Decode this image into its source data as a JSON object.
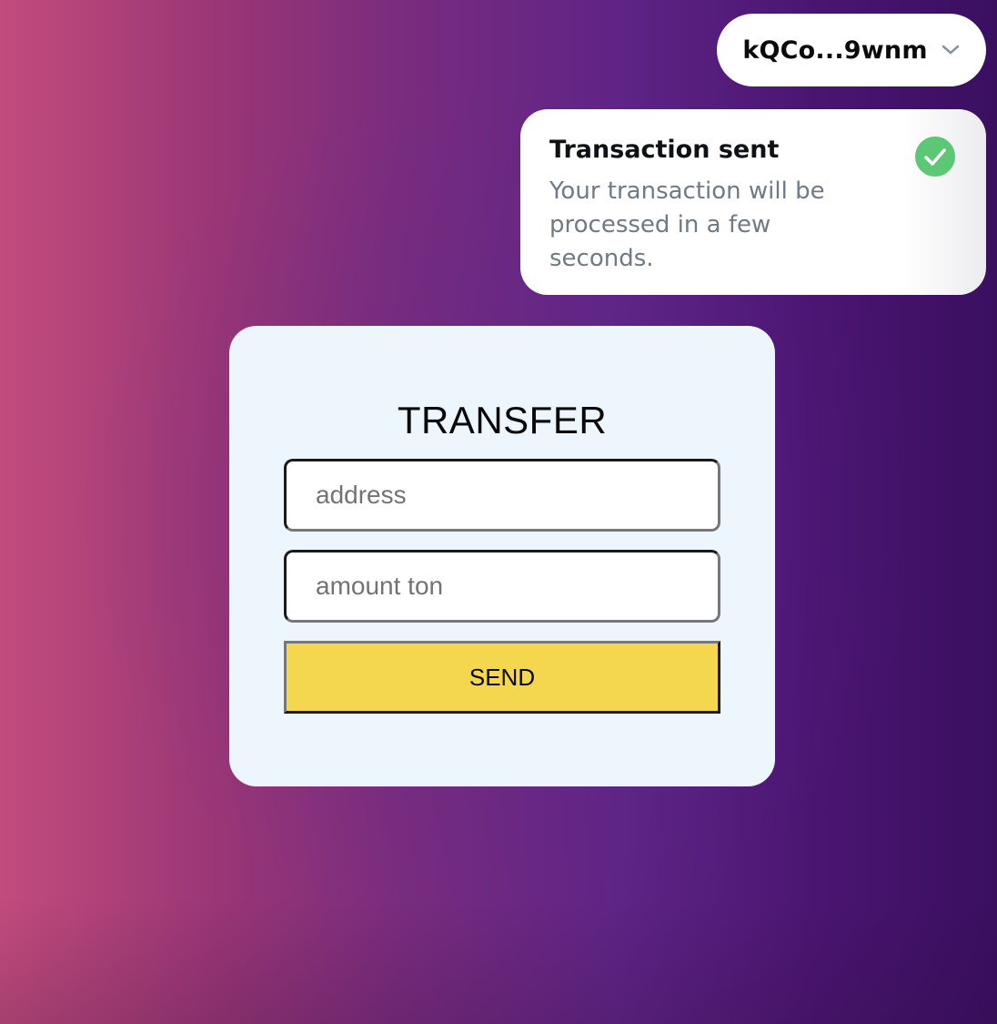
{
  "wallet": {
    "address": "kQCo...9wnm",
    "dropdown_icon": "chevron-down-icon"
  },
  "toast": {
    "title": "Transaction sent",
    "message": "Your transaction will be processed in a few seconds.",
    "status_icon": "check-circle-icon",
    "status_color": "#5cc775"
  },
  "transfer": {
    "title": "TRANSFER",
    "address_placeholder": "address",
    "address_value": "",
    "amount_placeholder": "amount ton",
    "amount_value": "",
    "send_label": "SEND",
    "send_color": "#f4d74f"
  },
  "colors": {
    "card_background": "#eef6fd",
    "gradient_start": "#c24c7c",
    "gradient_end": "#3a0f60"
  }
}
